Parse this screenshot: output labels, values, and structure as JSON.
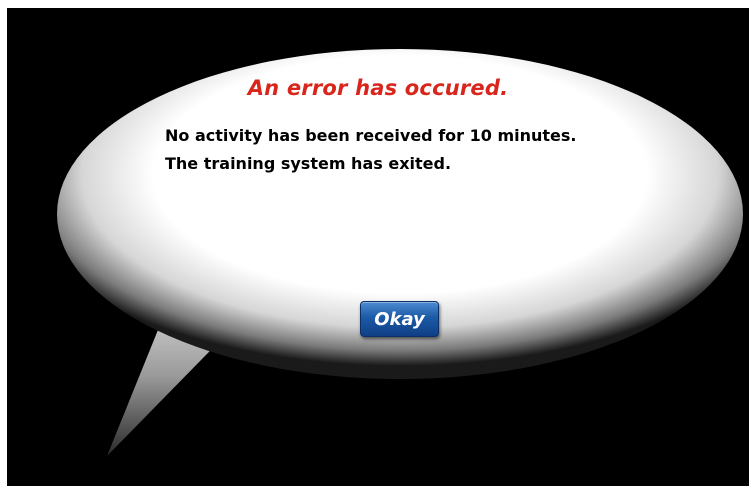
{
  "dialog": {
    "title": "An error has occured.",
    "message_lines": [
      "No activity has been received for 10 minutes.",
      "The training system has exited."
    ],
    "okay_label": "Okay"
  },
  "colors": {
    "background": "#000000",
    "bubble": "#ffffff",
    "title": "#d9261c",
    "message": "#000000",
    "button": "#1c5aa7",
    "button_text": "#ffffff"
  },
  "icons": {
    "speech_bubble": "speech-bubble-icon"
  }
}
